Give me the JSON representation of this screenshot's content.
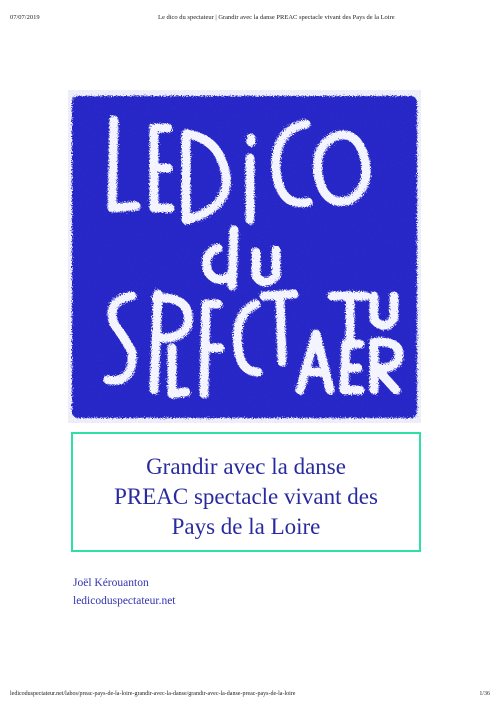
{
  "print_header": {
    "date": "07/07/2019",
    "title": "Le dico du spectateur | Grandir avec la danse PREAC spectacle vivant des Pays de la Loire"
  },
  "cover": {
    "logo_text": "LE DICO du SPECTATEUR",
    "background_color": "#2323c8",
    "letter_color": "#f4f4ff"
  },
  "title_box": {
    "lines": [
      "Grandir avec la danse",
      "PREAC spectacle vivant des",
      "Pays de la Loire"
    ],
    "border_color": "#2fe0a6"
  },
  "meta": {
    "author": "Joël Kérouanton",
    "site": "ledicoduspectateur.net"
  },
  "print_footer": {
    "url": "ledicoduspectateur.net/labos/preac-pays-de-la-loire-grandir-avec-la-danse/grandir-avec-la-danse-preac-pays-de-la-loire",
    "page": "1/36"
  }
}
